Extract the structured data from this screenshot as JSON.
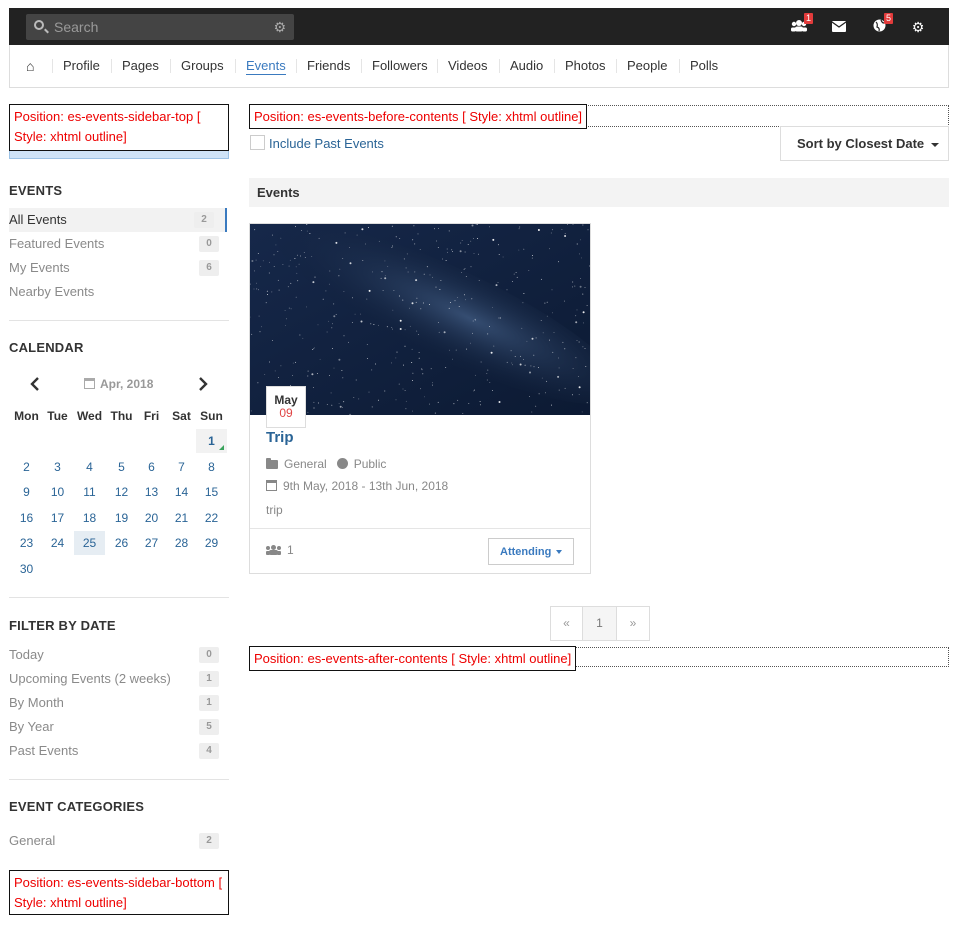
{
  "toolbar": {
    "search_placeholder": "Search",
    "icons": [
      {
        "name": "friend-requests-icon",
        "badge": "1"
      },
      {
        "name": "messages-icon",
        "badge": ""
      },
      {
        "name": "notifications-icon",
        "badge": "5"
      },
      {
        "name": "settings-icon",
        "badge": ""
      }
    ]
  },
  "nav": {
    "items": [
      "Profile",
      "Pages",
      "Groups",
      "Events",
      "Friends",
      "Followers",
      "Videos",
      "Audio",
      "Photos",
      "People",
      "Polls"
    ],
    "active": "Events"
  },
  "positions": {
    "sidebar_top": "Position: es-events-sidebar-top [ Style: xhtml outline]",
    "before_contents": "Position: es-events-before-contents [ Style: xhtml outline]",
    "after_contents": "Position: es-events-after-contents [ Style: xhtml outline]",
    "sidebar_bottom": "Position: es-events-sidebar-bottom [ Style: xhtml outline]"
  },
  "sidebar": {
    "events_heading": "EVENTS",
    "events": [
      {
        "label": "All Events",
        "count": "2",
        "active": true
      },
      {
        "label": "Featured Events",
        "count": "0"
      },
      {
        "label": "My Events",
        "count": "6"
      },
      {
        "label": "Nearby Events",
        "count": ""
      }
    ],
    "calendar_heading": "CALENDAR",
    "filter_heading": "FILTER BY DATE",
    "filters": [
      {
        "label": "Today",
        "count": "0"
      },
      {
        "label": "Upcoming Events (2 weeks)",
        "count": "1"
      },
      {
        "label": "By Month",
        "count": "1"
      },
      {
        "label": "By Year",
        "count": "5"
      },
      {
        "label": "Past Events",
        "count": "4"
      }
    ],
    "categories_heading": "EVENT CATEGORIES",
    "categories": [
      {
        "label": "General",
        "count": "2"
      }
    ]
  },
  "calendar": {
    "month_label": "Apr, 2018",
    "weekdays": [
      "Mon",
      "Tue",
      "Wed",
      "Thu",
      "Fri",
      "Sat",
      "Sun"
    ],
    "first_weekday_index": 6,
    "days_in_month": 30,
    "event_days": [
      1
    ],
    "today": 25
  },
  "main": {
    "include_past_label": "Include Past Events",
    "sort_label": "Sort by Closest Date",
    "section_title": "Events",
    "event": {
      "month": "May",
      "day": "09",
      "title": "Trip",
      "category": "General",
      "privacy": "Public",
      "dates": "9th May, 2018 - 13th Jun, 2018",
      "description": "trip",
      "attendees": "1",
      "rsvp_label": "Attending"
    },
    "pagination": {
      "prev": "«",
      "current": "1",
      "next": "»"
    }
  }
}
